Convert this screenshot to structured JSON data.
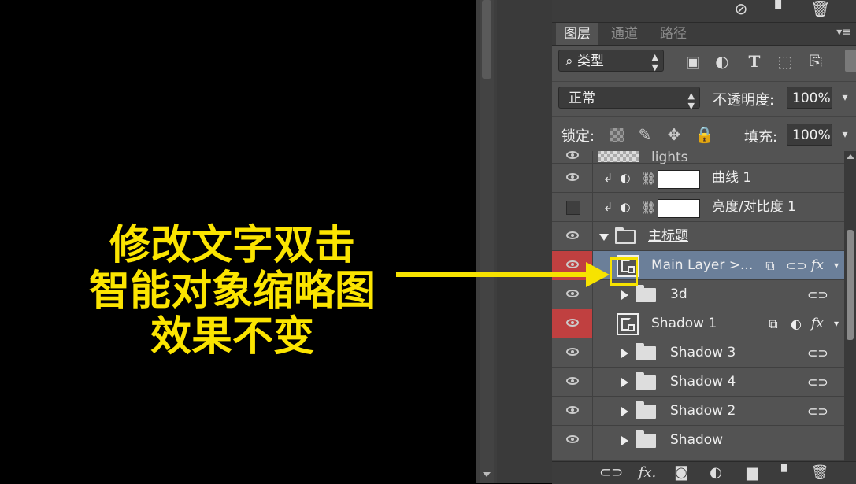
{
  "colors": {
    "annotation_text": "#fbe400",
    "arrow": "#f7e300",
    "panel_bg": "#535353",
    "selected_row": "#6b7f99",
    "visibility_highlight": "#c04040"
  },
  "top_strip": {
    "icons": [
      "no-entry-icon",
      "new-layer-icon",
      "trash-icon"
    ]
  },
  "tabs": [
    {
      "label": "图层",
      "active": true
    },
    {
      "label": "通道",
      "active": false
    },
    {
      "label": "路径",
      "active": false
    }
  ],
  "filter": {
    "kind_label": "类型",
    "icons": [
      "image-filter-icon",
      "adjustment-filter-icon",
      "type-filter-icon",
      "shape-filter-icon",
      "smart-object-filter-icon"
    ]
  },
  "blend": {
    "mode": "正常",
    "opacity_label": "不透明度:",
    "opacity_value": "100%"
  },
  "lock": {
    "label": "锁定:",
    "fill_label": "填充:",
    "fill_value": "100%"
  },
  "layers": [
    {
      "name": "lights",
      "type": "partial-top"
    },
    {
      "name": "曲线 1",
      "type": "adjustment",
      "visible": true
    },
    {
      "name": "亮度/对比度 1",
      "type": "adjustment",
      "visible": false
    },
    {
      "name": "主标题",
      "type": "group-open",
      "visible": true
    },
    {
      "name": "Main Layer >...",
      "type": "smart",
      "selected": true,
      "visible": true
    },
    {
      "name": "3d",
      "type": "group",
      "visible": true
    },
    {
      "name": "Shadow 1",
      "type": "smart",
      "visible": true
    },
    {
      "name": "Shadow 3",
      "type": "group",
      "visible": true
    },
    {
      "name": "Shadow 4",
      "type": "group",
      "visible": true
    },
    {
      "name": "Shadow 2",
      "type": "group",
      "visible": true
    },
    {
      "name": "Shadow",
      "type": "group",
      "visible": true
    }
  ],
  "bottom_bar": {
    "icons": [
      "link-layers-icon",
      "fx-icon",
      "add-mask-icon",
      "new-adjustment-icon",
      "new-group-icon",
      "new-layer-icon",
      "trash-icon"
    ],
    "fx_label": "fx."
  },
  "annotation": {
    "lines": [
      "修改文字双击",
      "智能对象缩略图",
      "效果不变"
    ]
  }
}
